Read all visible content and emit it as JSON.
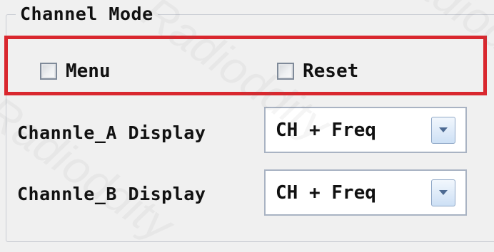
{
  "group": {
    "title": "Channel Mode"
  },
  "menu_checkbox": {
    "label": "Menu",
    "checked": false
  },
  "reset_checkbox": {
    "label": "Reset",
    "checked": false
  },
  "channel_a": {
    "label": "Channle_A Display",
    "value": "CH + Freq"
  },
  "channel_b": {
    "label": "Channle_B Display",
    "value": "CH + Freq"
  },
  "watermark": "Radioddity",
  "colors": {
    "highlight": "#d9272e",
    "background": "#f0f0f0"
  },
  "icons": {
    "combo_arrow": "chevron-down-icon"
  }
}
